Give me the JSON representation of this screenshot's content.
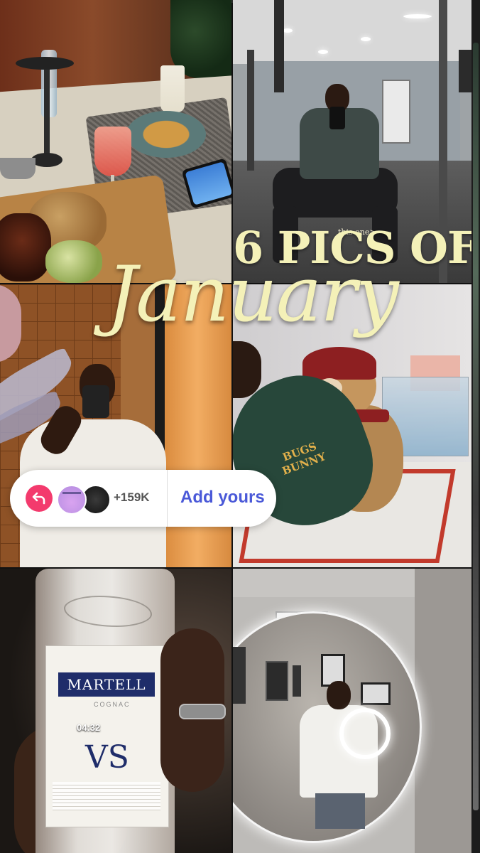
{
  "story": {
    "progress_fraction": 0.04,
    "title_line1": "6 PICS OF",
    "title_line2": "January",
    "caption": "this one>",
    "title_color": "#f4f1b8"
  },
  "tiles": {
    "bottle": {
      "brand": "MARTELL",
      "subbrand": "COGNAC",
      "grade": "VS",
      "video_time": "04:32"
    },
    "cap": {
      "text": "BUGS BUNNY"
    }
  },
  "add_yours": {
    "icon": "reply-arrow-icon",
    "count": "+159K",
    "label": "Add yours",
    "accent": "#4a59d8",
    "icon_color": "#f33a6d"
  }
}
